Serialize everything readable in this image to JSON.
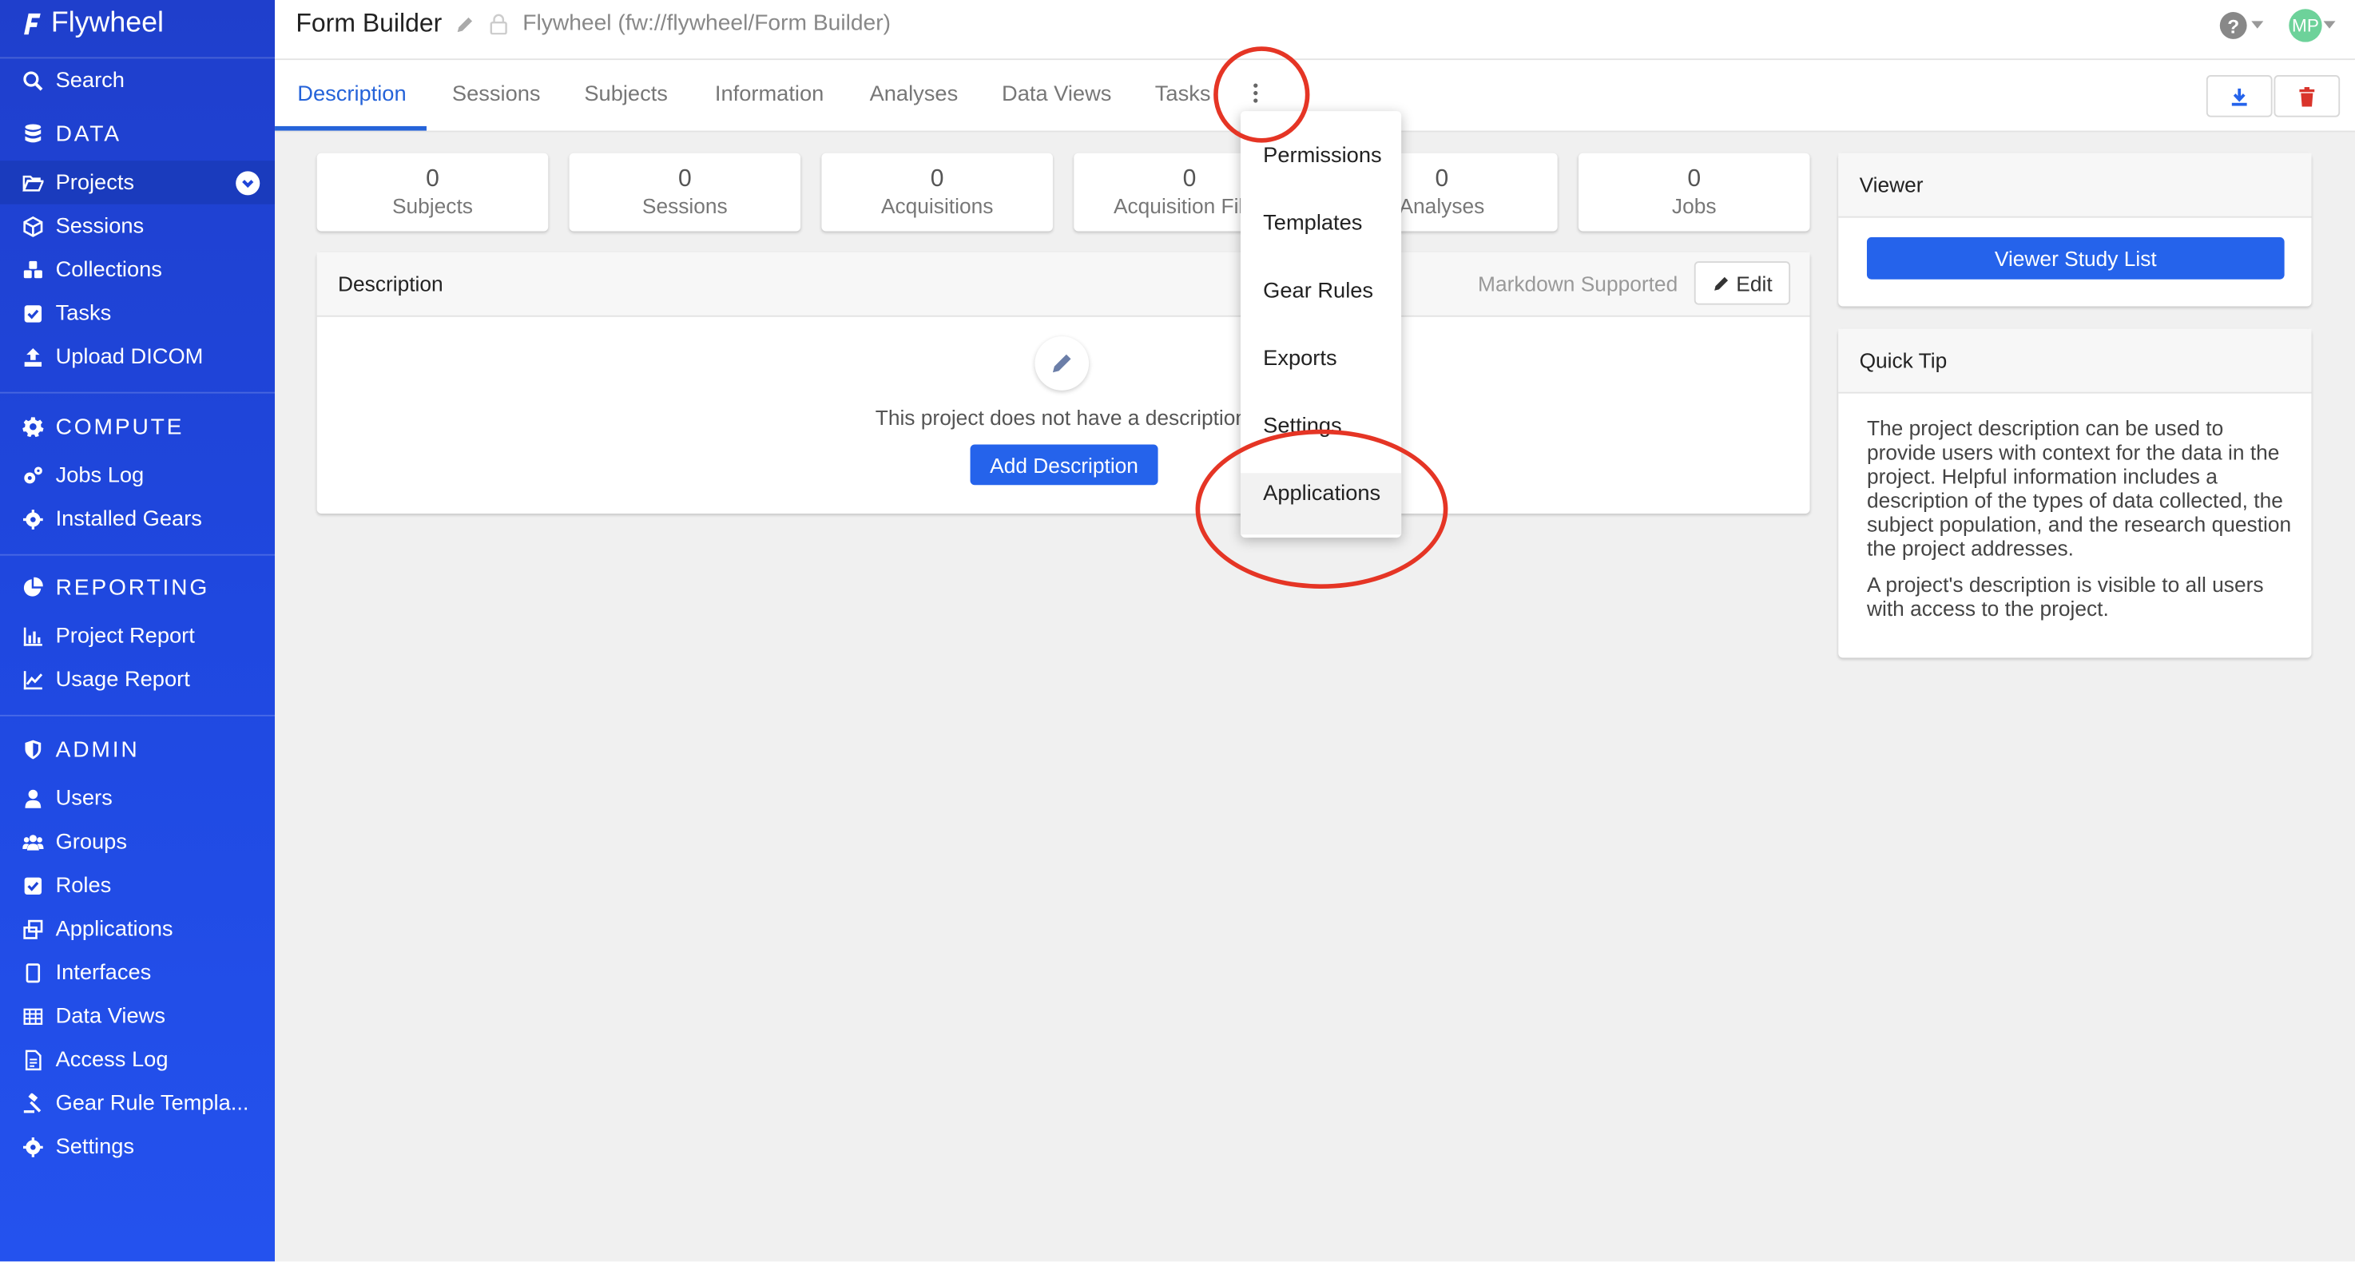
{
  "app": {
    "name": "Flywheel"
  },
  "sidebar": {
    "search": "Search",
    "sections": [
      {
        "label": "DATA",
        "items": [
          "Projects",
          "Sessions",
          "Collections",
          "Tasks",
          "Upload DICOM"
        ]
      },
      {
        "label": "COMPUTE",
        "items": [
          "Jobs Log",
          "Installed Gears"
        ]
      },
      {
        "label": "REPORTING",
        "items": [
          "Project Report",
          "Usage Report"
        ]
      },
      {
        "label": "ADMIN",
        "items": [
          "Users",
          "Groups",
          "Roles",
          "Applications",
          "Interfaces",
          "Data Views",
          "Access Log",
          "Gear Rule Templa...",
          "Settings"
        ]
      }
    ],
    "active_item": "Projects"
  },
  "header": {
    "title": "Form Builder",
    "breadcrumb": "Flywheel (fw://flywheel/Form Builder)",
    "help": "?",
    "user_initials": "MP"
  },
  "tabs": [
    "Description",
    "Sessions",
    "Subjects",
    "Information",
    "Analyses",
    "Data Views",
    "Tasks"
  ],
  "active_tab": "Description",
  "stats": [
    {
      "value": "0",
      "label": "Subjects"
    },
    {
      "value": "0",
      "label": "Sessions"
    },
    {
      "value": "0",
      "label": "Acquisitions"
    },
    {
      "value": "0",
      "label": "Acquisition Files"
    },
    {
      "value": "0",
      "label": "Analyses"
    },
    {
      "value": "0",
      "label": "Jobs"
    }
  ],
  "description_panel": {
    "title": "Description",
    "markdown_note": "Markdown Supported",
    "edit_label": "Edit",
    "empty_message": "This project does not have a description.",
    "add_button": "Add Description"
  },
  "viewer_panel": {
    "title": "Viewer",
    "button": "Viewer Study List"
  },
  "quick_tip": {
    "title": "Quick Tip",
    "paragraphs": [
      "The project description can be used to provide users with context for the data in the project. Helpful information includes a description of the types of data collected, the subject population, and the research question the project addresses.",
      "A project's description is visible to all users with access to the project."
    ]
  },
  "more_menu": {
    "items": [
      "Permissions",
      "Templates",
      "Gear Rules",
      "Exports",
      "Settings",
      "Applications"
    ],
    "highlighted": "Applications"
  },
  "colors": {
    "sidebar": "#1f45d8",
    "accent": "#2563eb",
    "annotation": "#e53525",
    "danger": "#d9342b"
  }
}
